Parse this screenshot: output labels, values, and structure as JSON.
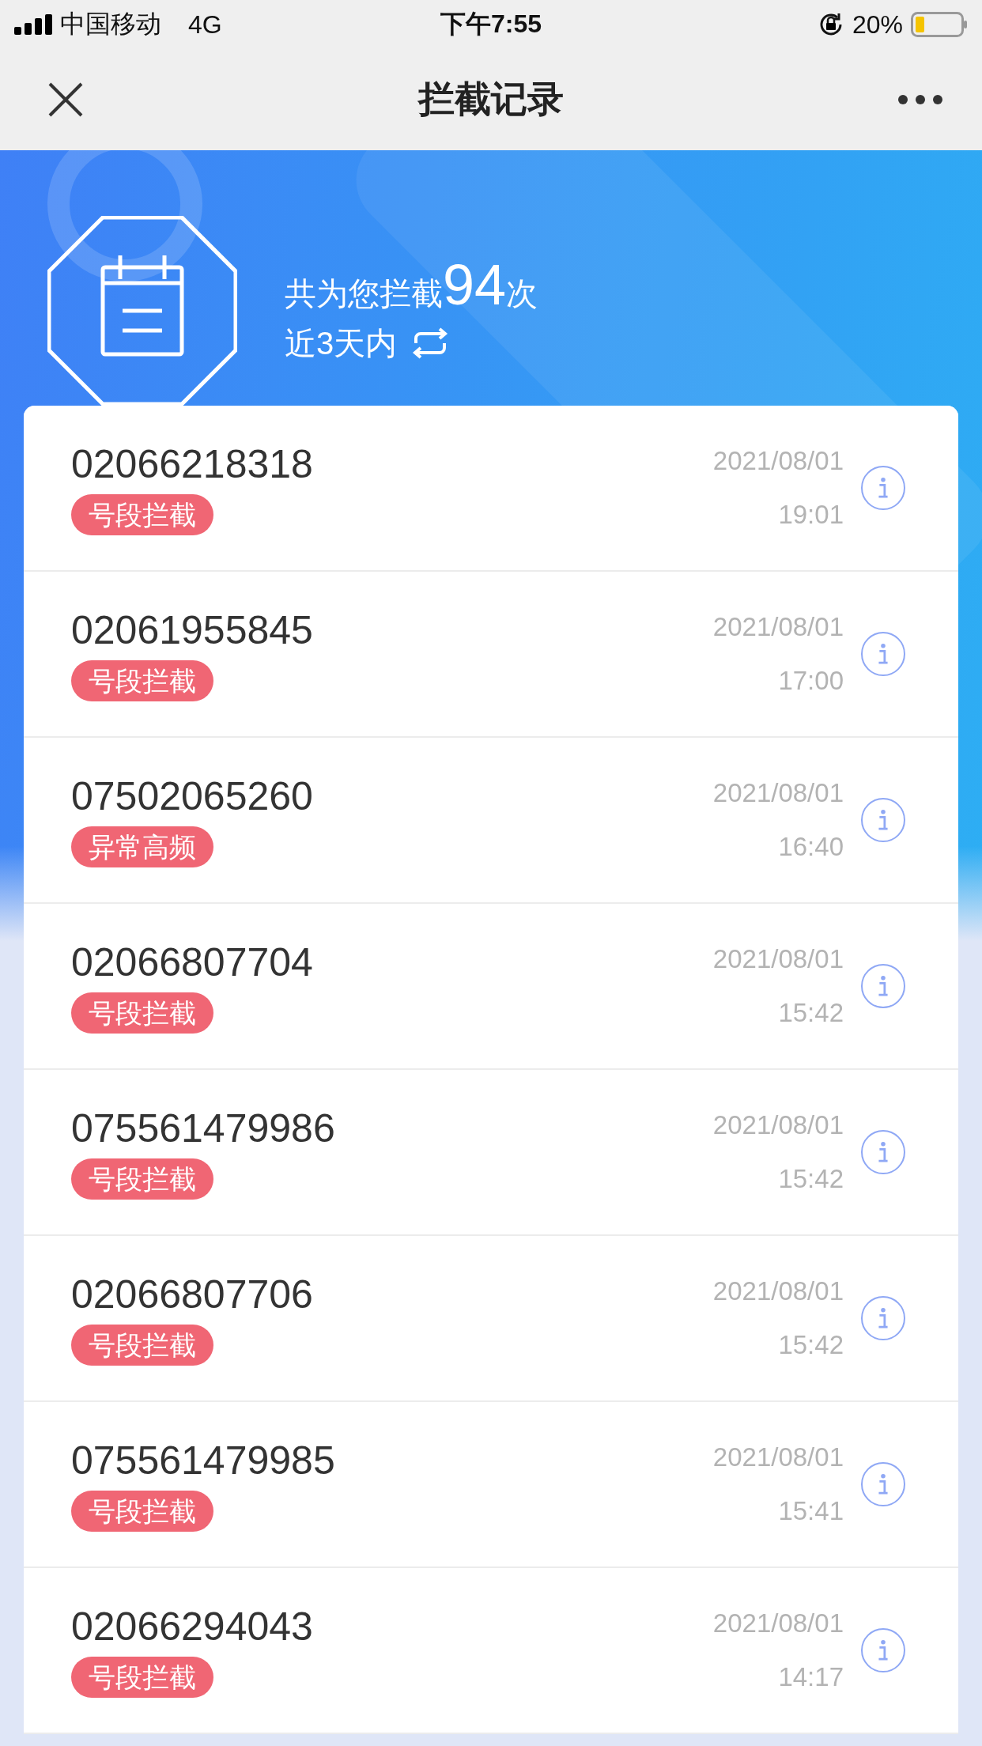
{
  "status_bar": {
    "carrier": "中国移动",
    "network": "4G",
    "time": "下午7:55",
    "battery": "20%"
  },
  "nav": {
    "title": "拦截记录"
  },
  "summary": {
    "prefix": "共为您拦截",
    "count": "94",
    "suffix": "次",
    "period": "近3天内"
  },
  "records": [
    {
      "number": "02066218318",
      "tag": "号段拦截",
      "date": "2021/08/01",
      "time": "19:01"
    },
    {
      "number": "02061955845",
      "tag": "号段拦截",
      "date": "2021/08/01",
      "time": "17:00"
    },
    {
      "number": "07502065260",
      "tag": "异常高频",
      "date": "2021/08/01",
      "time": "16:40"
    },
    {
      "number": "02066807704",
      "tag": "号段拦截",
      "date": "2021/08/01",
      "time": "15:42"
    },
    {
      "number": "075561479986",
      "tag": "号段拦截",
      "date": "2021/08/01",
      "time": "15:42"
    },
    {
      "number": "02066807706",
      "tag": "号段拦截",
      "date": "2021/08/01",
      "time": "15:42"
    },
    {
      "number": "075561479985",
      "tag": "号段拦截",
      "date": "2021/08/01",
      "time": "15:41"
    },
    {
      "number": "02066294043",
      "tag": "号段拦截",
      "date": "2021/08/01",
      "time": "14:17"
    }
  ]
}
